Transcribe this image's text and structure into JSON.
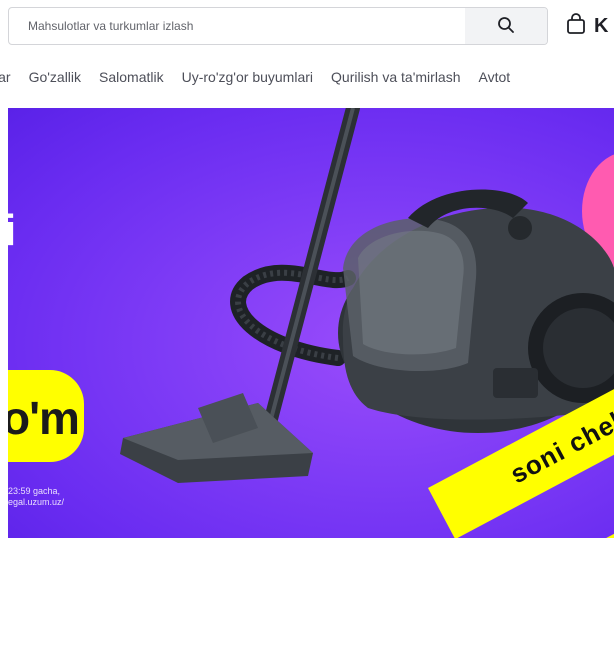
{
  "search": {
    "placeholder": "Mahsulotlar va turkumlar izlash"
  },
  "header": {
    "cart_label": "K"
  },
  "categories": [
    "lar",
    "Go'zallik",
    "Salomatlik",
    "Uy-ro'zg'or buyumlari",
    "Qurilish va ta'mirlash",
    "Avtot"
  ],
  "banner": {
    "headline_fragment": "i",
    "pill_text": "o'm",
    "small_line_1": "23:59 gacha,",
    "small_line_2": "egal.uzum.uz/",
    "tape_text": "soni chekl",
    "colors": {
      "background": "#7f3cf6",
      "accent_yellow": "#ffff00",
      "accent_pink": "#ff5bb0"
    }
  },
  "icons": {
    "search": "search-icon",
    "cart": "shopping-bag-icon"
  }
}
